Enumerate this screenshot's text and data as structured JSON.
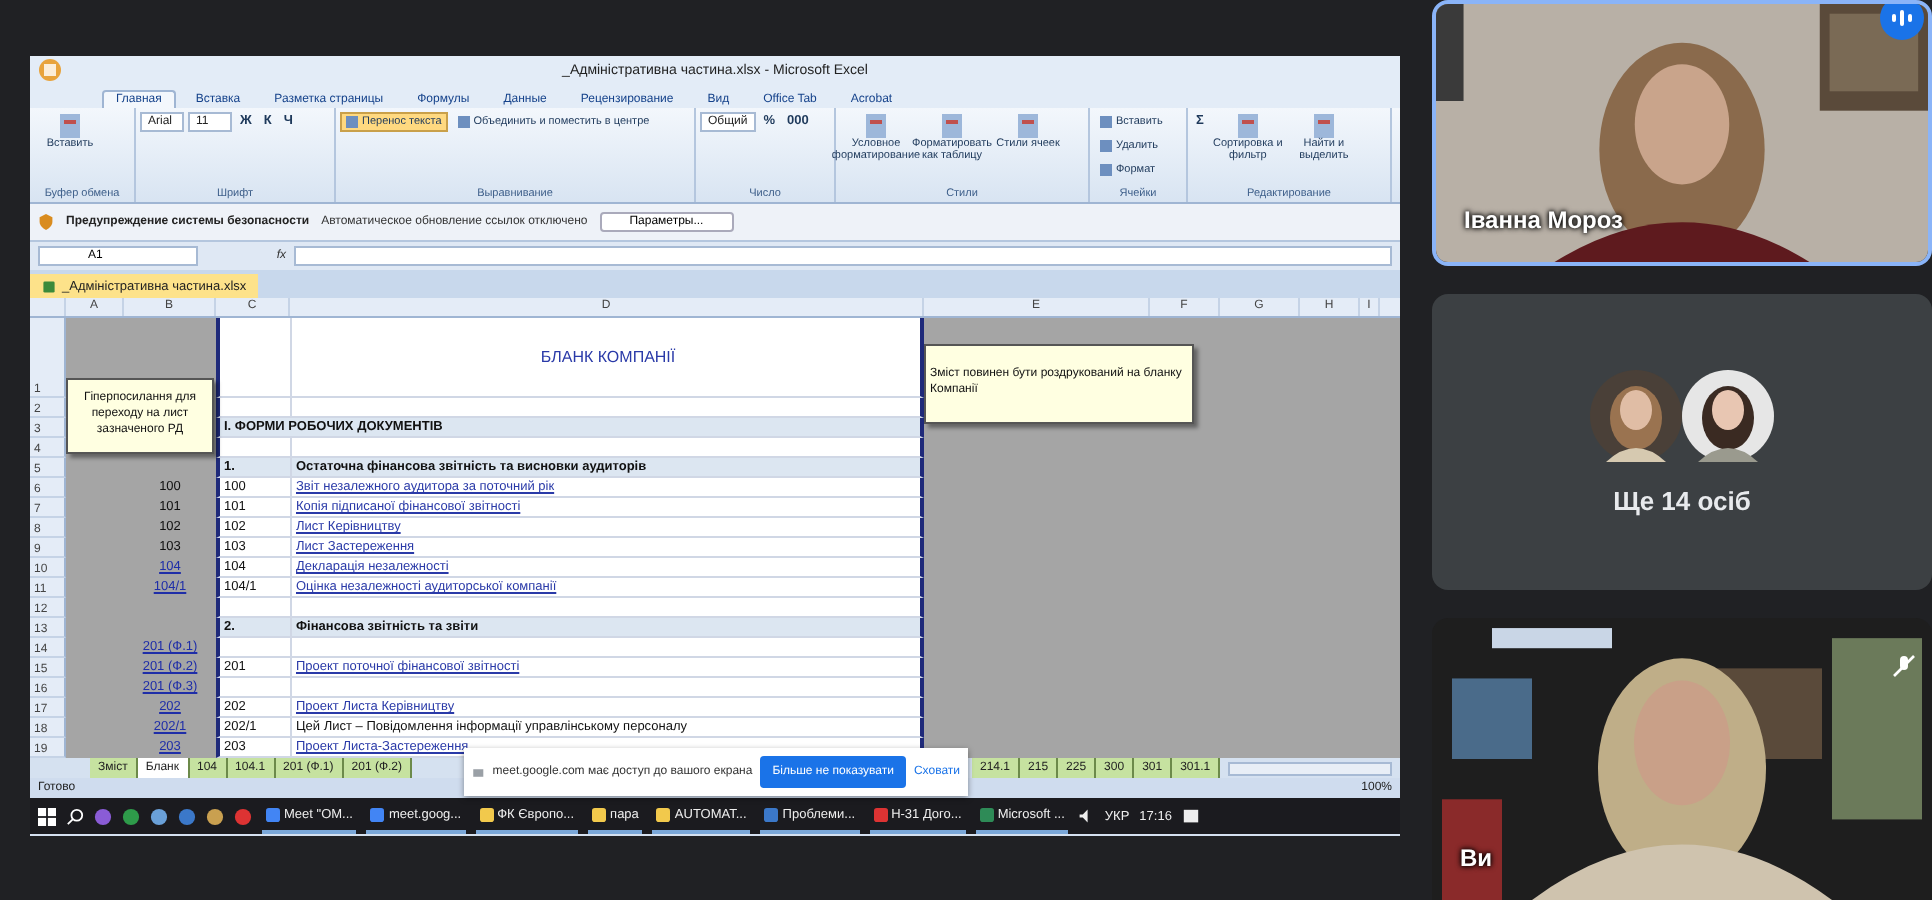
{
  "excel": {
    "title": "_Адміністративна частина.xlsx - Microsoft Excel",
    "ribbon_tabs": [
      {
        "label": "Главная",
        "selected": true
      },
      {
        "label": "Вставка",
        "selected": false
      },
      {
        "label": "Разметка страницы",
        "selected": false
      },
      {
        "label": "Формулы",
        "selected": false
      },
      {
        "label": "Данные",
        "selected": false
      },
      {
        "label": "Рецензирование",
        "selected": false
      },
      {
        "label": "Вид",
        "selected": false
      },
      {
        "label": "Office Tab",
        "selected": false
      },
      {
        "label": "Acrobat",
        "selected": false
      }
    ],
    "ribbon_groups": [
      {
        "label": "Буфер обмена",
        "items": [
          {
            "kind": "big",
            "label": "Вставить"
          }
        ]
      },
      {
        "label": "Шрифт",
        "items": [
          {
            "kind": "field",
            "label": "Arial"
          },
          {
            "kind": "field",
            "label": "11"
          },
          {
            "kind": "glyph",
            "label": "Ж"
          },
          {
            "kind": "glyph",
            "label": "К"
          },
          {
            "kind": "glyph",
            "label": "Ч"
          }
        ]
      },
      {
        "label": "Выравнивание",
        "items": [
          {
            "kind": "small",
            "label": "Перенос текста",
            "active": true
          },
          {
            "kind": "small",
            "label": "Объединить и поместить в центре",
            "active": false
          }
        ]
      },
      {
        "label": "Число",
        "items": [
          {
            "kind": "field",
            "label": "Общий"
          },
          {
            "kind": "glyph",
            "label": "%"
          },
          {
            "kind": "glyph",
            "label": "000"
          }
        ]
      },
      {
        "label": "Стили",
        "items": [
          {
            "kind": "big",
            "label": "Условное форматирование"
          },
          {
            "kind": "big",
            "label": "Форматировать как таблицу"
          },
          {
            "kind": "big",
            "label": "Стили ячеек"
          }
        ]
      },
      {
        "label": "Ячейки",
        "items": [
          {
            "kind": "small",
            "label": "Вставить",
            "active": false
          },
          {
            "kind": "small",
            "label": "Удалить",
            "active": false
          },
          {
            "kind": "small",
            "label": "Формат",
            "active": false
          }
        ]
      },
      {
        "label": "Редактирование",
        "items": [
          {
            "kind": "glyph",
            "label": "Σ"
          },
          {
            "kind": "big",
            "label": "Сортировка и фильтр"
          },
          {
            "kind": "big",
            "label": "Найти и выделить"
          }
        ]
      }
    ],
    "security_bar": {
      "title": "Предупреждение системы безопасности",
      "message": "Автоматическое обновление ссылок отключено",
      "button": "Параметры..."
    },
    "name_box": "A1",
    "formula_label": "fx",
    "document_tab": "_Адміністративна частина.xlsx",
    "columns": [
      "A",
      "B",
      "C",
      "D",
      "E",
      "F",
      "G",
      "H",
      "I"
    ],
    "rows": [
      {
        "number": "1",
        "kind": "title",
        "d": "БЛАНК КОМПАНІЇ"
      },
      {
        "number": "2",
        "kind": "blank"
      },
      {
        "number": "3",
        "kind": "section",
        "c": "І. ФОРМИ РОБОЧИХ ДОКУМЕНТІВ"
      },
      {
        "number": "4",
        "kind": "blank"
      },
      {
        "number": "5",
        "kind": "heading",
        "c": "1.",
        "d": "Остаточна фінансова звітність та висновки аудиторів"
      },
      {
        "number": "6",
        "kind": "item",
        "b": "100",
        "b_link": false,
        "c": "100",
        "d": "Звіт незалежного аудитора за поточний рік",
        "d_link": true
      },
      {
        "number": "7",
        "kind": "item",
        "b": "101",
        "b_link": false,
        "c": "101",
        "d": "Копія підписаної фінансової звітності",
        "d_link": true
      },
      {
        "number": "8",
        "kind": "item",
        "b": "102",
        "b_link": false,
        "c": "102",
        "d": "Лист Керівництву",
        "d_link": true
      },
      {
        "number": "9",
        "kind": "item",
        "b": "103",
        "b_link": false,
        "c": "103",
        "d": "Лист Застереження",
        "d_link": true
      },
      {
        "number": "10",
        "kind": "item",
        "b": "104",
        "b_link": true,
        "c": "104",
        "d": "Декларація незалежності",
        "d_link": true
      },
      {
        "number": "11",
        "kind": "item",
        "b": "104/1",
        "b_link": true,
        "c": "104/1",
        "d": "Оцінка незалежності аудиторської компанії",
        "d_link": true
      },
      {
        "number": "12",
        "kind": "blank"
      },
      {
        "number": "13",
        "kind": "heading",
        "c": "2.",
        "d": "Фінансова звітність та звіти"
      },
      {
        "number": "14",
        "kind": "item",
        "b": "201 (Ф.1)",
        "b_link": true
      },
      {
        "number": "15",
        "kind": "item",
        "b": "201 (Ф.2)",
        "b_link": true,
        "c": "201",
        "d": "Проект поточної фінансової звітності",
        "d_link": true
      },
      {
        "number": "16",
        "kind": "item",
        "b": "201 (Ф.3)",
        "b_link": true
      },
      {
        "number": "17",
        "kind": "item",
        "b": "202",
        "b_link": true,
        "c": "202",
        "d": "Проект Листа Керівництву",
        "d_link": true
      },
      {
        "number": "18",
        "kind": "item",
        "b": "202/1",
        "b_link": true,
        "c": "202/1",
        "d": "Цей Лист – Повідомлення інформації управлінському персоналу",
        "d_link": false
      },
      {
        "number": "19",
        "kind": "item",
        "b": "203",
        "b_link": true,
        "c": "203",
        "d": "Проект Листа-Застереження",
        "d_link": true
      }
    ],
    "comments": [
      {
        "text": "Гіперпосилання для переходу на лист зазначеного РД",
        "kind": "left"
      },
      {
        "text": "Зміст повинен бути роздрукований на бланку Компанії",
        "kind": "right"
      }
    ],
    "sheet_tabs": [
      {
        "label": "Зміст",
        "selected": false
      },
      {
        "label": "Бланк",
        "selected": true
      },
      {
        "label": "104",
        "selected": false
      },
      {
        "label": "104.1",
        "selected": false
      },
      {
        "label": "201 (Ф.1)",
        "selected": false
      },
      {
        "label": "201 (Ф.2)",
        "selected": false
      }
    ],
    "sheet_tabs_right": [
      {
        "label": "214.1",
        "selected": false
      },
      {
        "label": "215",
        "selected": false
      },
      {
        "label": "225",
        "selected": false
      },
      {
        "label": "300",
        "selected": false
      },
      {
        "label": "301",
        "selected": false
      },
      {
        "label": "301.1",
        "selected": false
      }
    ],
    "status": "Готово",
    "zoom": "100%"
  },
  "share_bar": {
    "message": "meet.google.com має доступ до вашого екрана",
    "primary_button": "Більше не показувати",
    "secondary_button": "Сховати"
  },
  "taskbar": {
    "apps": [
      {
        "label": "Meet \"ОМ..."
      },
      {
        "label": "meet.goog..."
      },
      {
        "label": "ФК Європо..."
      },
      {
        "label": "пара"
      },
      {
        "label": "AUTOMAT..."
      },
      {
        "label": "Проблеми..."
      },
      {
        "label": "Н-31 Дого..."
      },
      {
        "label": "Microsoft ..."
      }
    ],
    "language": "УКР",
    "time": "17:16"
  },
  "participants": [
    {
      "kind": "video",
      "name": "Іванна Мороз",
      "speaking": true
    },
    {
      "kind": "others",
      "label": "Ще 14 осіб"
    },
    {
      "kind": "self",
      "name": "Ви",
      "muted": true
    }
  ]
}
